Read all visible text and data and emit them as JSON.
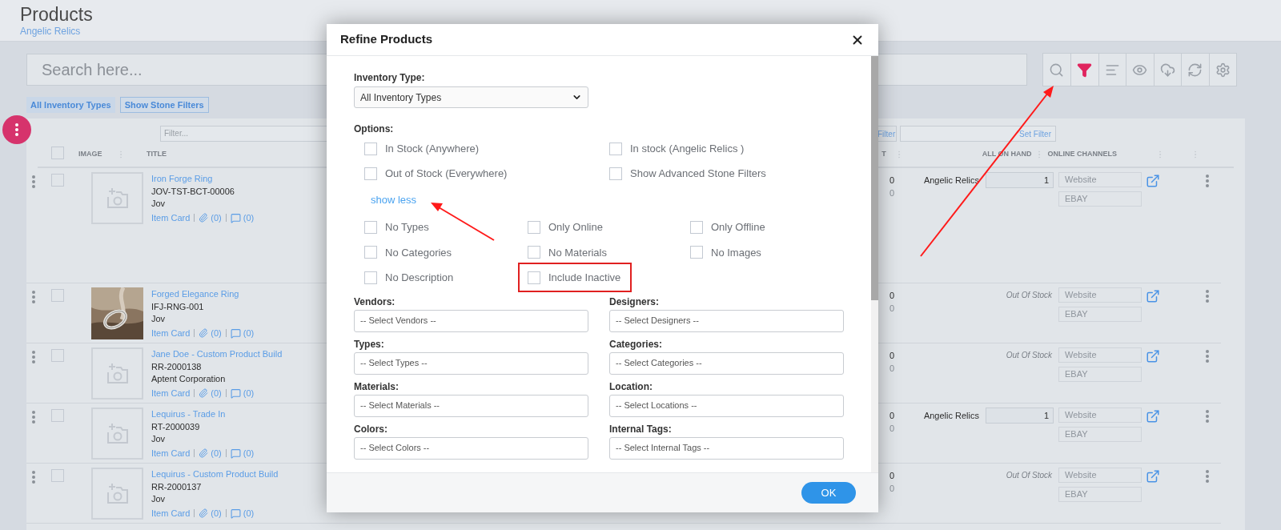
{
  "page": {
    "title": "Products",
    "subtitle": "Angelic Relics"
  },
  "search": {
    "placeholder": "Search here..."
  },
  "toolbar": [
    {
      "kind": "search-options",
      "active": false
    },
    {
      "kind": "filter",
      "active": true
    },
    {
      "kind": "sort",
      "active": false
    },
    {
      "kind": "view",
      "active": false
    },
    {
      "kind": "download",
      "active": false
    },
    {
      "kind": "sync",
      "active": false
    },
    {
      "kind": "settings",
      "active": false
    }
  ],
  "chips": [
    {
      "label": "All Inventory Types",
      "kind": "filled"
    },
    {
      "label": "Show Stone Filters",
      "kind": "outlined"
    }
  ],
  "table": {
    "filter_placeholder": "Filter...",
    "filter_link": "Filter",
    "set_filter": "Set Filter",
    "select_all_checked": false,
    "columns": {
      "image": "IMAGE",
      "title": "TITLE",
      "column_3": "T",
      "on_hand": "ALL ON HAND",
      "channels": "ONLINE CHANNELS"
    },
    "rows": [
      {
        "title": "Iron Forge Ring",
        "sku": "JOV-TST-BCT-00006",
        "owner": "Jov",
        "item_card": "Item Card",
        "attachments": "(0)",
        "comments": "(0)",
        "checked": false,
        "image": {
          "kind": "placeholder"
        },
        "column_3": [
          "0",
          "0"
        ],
        "stock": {
          "kind": "location",
          "location": "Angelic Relics",
          "quantity": "1"
        },
        "channels": [
          "Website",
          "EBAY"
        ]
      },
      {
        "title": "Forged Elegance Ring",
        "sku": "IFJ-RNG-001",
        "owner": "Jov",
        "item_card": "Item Card",
        "attachments": "(0)",
        "comments": "(0)",
        "checked": false,
        "column_3": [
          "0",
          "0"
        ],
        "stock": {
          "kind": "out",
          "label": "Out Of Stock"
        },
        "channels": [
          "Website",
          "EBAY"
        ]
      },
      {
        "title": "Jane Doe - Custom Product Build",
        "sku": "RR-2000138",
        "owner": "Aptent Corporation",
        "item_card": "Item Card",
        "attachments": "(0)",
        "comments": "(0)",
        "checked": false,
        "image": {
          "kind": "placeholder"
        },
        "column_3": [
          "0",
          "0"
        ],
        "stock": {
          "kind": "out",
          "label": "Out Of Stock"
        },
        "channels": [
          "Website",
          "EBAY"
        ]
      },
      {
        "title": "Lequirus - Trade In",
        "sku": "RT-2000039",
        "owner": "Jov",
        "item_card": "Item Card",
        "attachments": "(0)",
        "comments": "(0)",
        "checked": false,
        "image": {
          "kind": "placeholder"
        },
        "column_3": [
          "0",
          "0"
        ],
        "stock": {
          "kind": "location",
          "location": "Angelic Relics",
          "quantity": "1"
        },
        "channels": [
          "Website",
          "EBAY"
        ]
      },
      {
        "title": "Lequirus - Custom Product Build",
        "sku": "RR-2000137",
        "owner": "Jov",
        "item_card": "Item Card",
        "attachments": "(0)",
        "comments": "(0)",
        "checked": false,
        "image": {
          "kind": "placeholder"
        },
        "column_3": [
          "0",
          "0"
        ],
        "stock": {
          "kind": "out",
          "label": "Out Of Stock"
        },
        "channels": [
          "Website",
          "EBAY"
        ]
      }
    ]
  },
  "dialog": {
    "title": "Refine Products",
    "inventory_type": {
      "label": "Inventory Type:",
      "value": "All Inventory Types"
    },
    "options_label": "Options:",
    "options": [
      {
        "label": "In Stock (Anywhere)",
        "checked": false
      },
      {
        "label": "In stock (Angelic Relics )",
        "checked": false
      },
      {
        "label": "Out of Stock (Everywhere)",
        "checked": false
      },
      {
        "label": "Show Advanced Stone Filters",
        "checked": false
      }
    ],
    "toggle_link": "show less",
    "more_options": [
      {
        "label": "No Types",
        "checked": false,
        "highlighted": false
      },
      {
        "label": "Only Online",
        "checked": false,
        "highlighted": false
      },
      {
        "label": "Only Offline",
        "checked": false,
        "highlighted": false
      },
      {
        "label": "No Categories",
        "checked": false,
        "highlighted": false
      },
      {
        "label": "No Materials",
        "checked": false,
        "highlighted": false
      },
      {
        "label": "No Images",
        "checked": false,
        "highlighted": false
      },
      {
        "label": "No Description",
        "checked": false,
        "highlighted": false
      },
      {
        "label": "Include Inactive",
        "checked": false,
        "highlighted": true
      }
    ],
    "selects": [
      {
        "label": "Vendors:",
        "placeholder": "-- Select Vendors --"
      },
      {
        "label": "Designers:",
        "placeholder": "-- Select Designers --"
      },
      {
        "label": "Types:",
        "placeholder": "-- Select Types --"
      },
      {
        "label": "Categories:",
        "placeholder": "-- Select Categories --"
      },
      {
        "label": "Materials:",
        "placeholder": "-- Select Materials --"
      },
      {
        "label": "Location:",
        "placeholder": "-- Select Locations --"
      },
      {
        "label": "Colors:",
        "placeholder": "-- Select Colors --"
      },
      {
        "label": "Internal Tags:",
        "placeholder": "-- Select Internal Tags --"
      }
    ],
    "ok": "OK"
  }
}
